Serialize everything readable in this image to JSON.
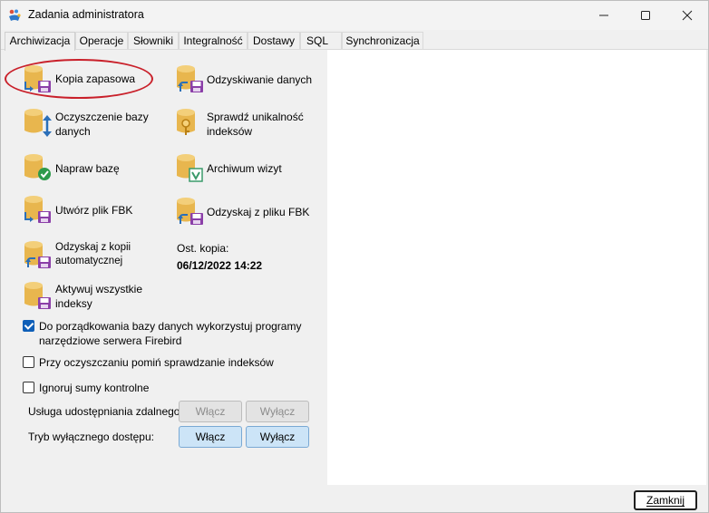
{
  "window": {
    "title": "Zadania administratora",
    "controls": {
      "minimize": "minimize-icon",
      "maximize": "maximize-icon",
      "close": "close-icon"
    }
  },
  "tabs": [
    {
      "label": "Archiwizacja",
      "active": true
    },
    {
      "label": "Operacje",
      "active": false
    },
    {
      "label": "Słowniki",
      "active": false
    },
    {
      "label": "Integralność",
      "active": false
    },
    {
      "label": "Dostawy",
      "active": false
    },
    {
      "label": "SQL",
      "active": false
    },
    {
      "label": "Synchronizacja",
      "active": false
    }
  ],
  "actions": {
    "backup": "Kopia zapasowa",
    "recover": "Odzyskiwanie danych",
    "cleanup": "Oczyszczenie bazy danych",
    "check_unique": "Sprawdź unikalność indeksów",
    "repair": "Napraw bazę",
    "visit_archive": "Archiwum wizyt",
    "create_fbk": "Utwórz plik FBK",
    "recover_fbk": "Odzyskaj z pliku FBK",
    "recover_auto": "Odzyskaj z kopii automatycznej",
    "activate_indexes": "Aktywuj wszystkie indeksy"
  },
  "last_backup": {
    "label": "Ost. kopia:",
    "value": "06/12/2022 14:22"
  },
  "options": {
    "use_firebird_tools": {
      "label": "Do porządkowania bazy danych wykorzystuj programy narzędziowe serwera Firebird",
      "checked": true
    },
    "skip_index_check": {
      "label": "Przy oczyszczaniu pomiń sprawdzanie indeksów",
      "checked": false
    },
    "ignore_checksums": {
      "label": "Ignoruj sumy kontrolne",
      "checked": false
    }
  },
  "remote_sharing": {
    "label": "Usługa udostępniania zdalnego:",
    "enable": "Włącz",
    "disable": "Wyłącz",
    "state": "disabled"
  },
  "exclusive_mode": {
    "label": "Tryb wyłącznego dostępu:",
    "enable": "Włącz",
    "disable": "Wyłącz"
  },
  "footer": {
    "close": "Zamknij"
  },
  "colors": {
    "db_gold": "#e8b64e",
    "accent_blue": "#0f5fb8",
    "annotation_red": "#c9202a"
  }
}
